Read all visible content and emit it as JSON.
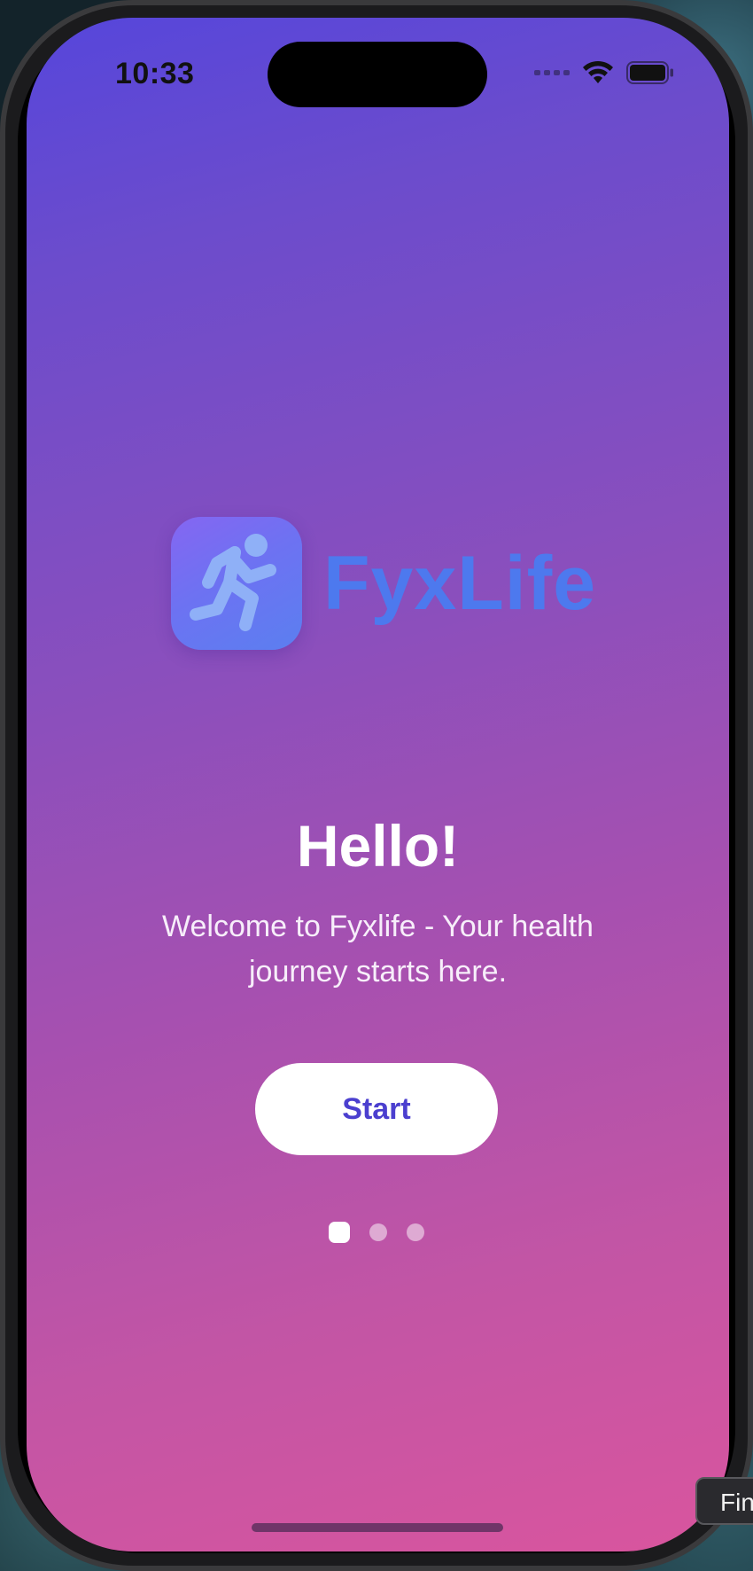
{
  "status_bar": {
    "time": "10:33",
    "wifi_icon": "wifi-icon",
    "battery_icon": "battery-full-icon"
  },
  "logo": {
    "icon": "running-person-icon",
    "brand_name": "FyxLife",
    "brand_color": "#4d79ee"
  },
  "greeting": {
    "title": "Hello!",
    "subtitle": "Welcome to Fyxlife - Your health journey starts here."
  },
  "actions": {
    "start_label": "Start"
  },
  "pager": {
    "total_pages": 3,
    "current_page": 1
  },
  "desktop": {
    "finder_tooltip": "Fin"
  },
  "colors": {
    "gradient_top": "#5646db",
    "gradient_bottom": "#d9559e",
    "button_text": "#4b3fcf"
  }
}
